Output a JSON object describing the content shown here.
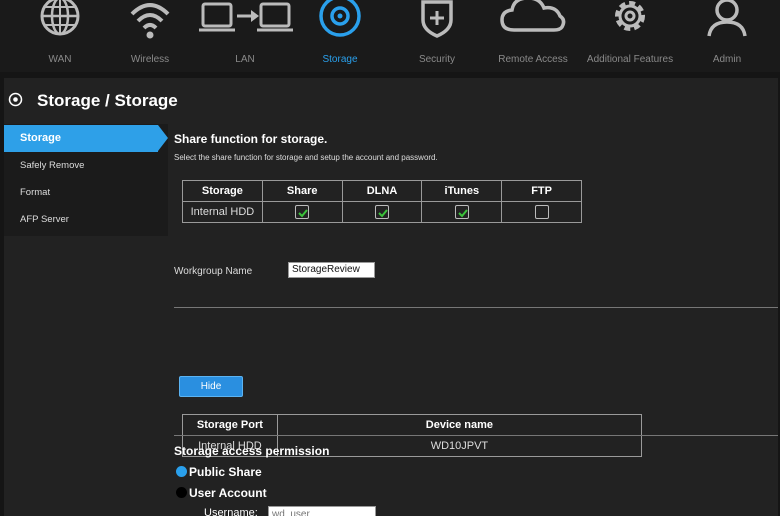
{
  "nav": {
    "items": [
      {
        "label": "WAN",
        "icon": "globe-icon",
        "active": false
      },
      {
        "label": "Wireless",
        "icon": "wifi-icon",
        "active": false
      },
      {
        "label": "LAN",
        "icon": "lan-icon",
        "active": false
      },
      {
        "label": "Storage",
        "icon": "storage-icon",
        "active": true
      },
      {
        "label": "Security",
        "icon": "shield-icon",
        "active": false
      },
      {
        "label": "Remote Access",
        "icon": "cloud-icon",
        "active": false
      },
      {
        "label": "Additional Features",
        "icon": "gear-icon",
        "active": false
      },
      {
        "label": "Admin",
        "icon": "user-icon",
        "active": false
      }
    ]
  },
  "page": {
    "title": "Storage / Storage"
  },
  "side": {
    "items": [
      {
        "label": "Storage",
        "active": true
      },
      {
        "label": "Safely Remove",
        "active": false
      },
      {
        "label": "Format",
        "active": false
      },
      {
        "label": "AFP Server",
        "active": false
      }
    ]
  },
  "share": {
    "heading": "Share function for storage.",
    "description": "Select the share function for storage and setup the account and password.",
    "columns": [
      "Storage",
      "Share",
      "DLNA",
      "iTunes",
      "FTP"
    ],
    "row": {
      "storage": "Internal HDD",
      "share": true,
      "dlna": true,
      "itunes": true,
      "ftp": false
    }
  },
  "workgroup": {
    "label": "Workgroup Name",
    "value": "StorageReview"
  },
  "hide_label": "Hide",
  "device": {
    "columns": [
      "Storage Port",
      "Device name"
    ],
    "row": {
      "port": "Internal HDD",
      "name": "WD10JPVT"
    }
  },
  "access": {
    "heading": "Storage access permission",
    "options": [
      {
        "label": "Public Share",
        "selected": true
      },
      {
        "label": "User Account",
        "selected": false
      }
    ],
    "username_label": "Username:",
    "username_placeholder": "wd_user"
  },
  "colors": {
    "accent": "#2ea0e8",
    "background": "#222222"
  }
}
